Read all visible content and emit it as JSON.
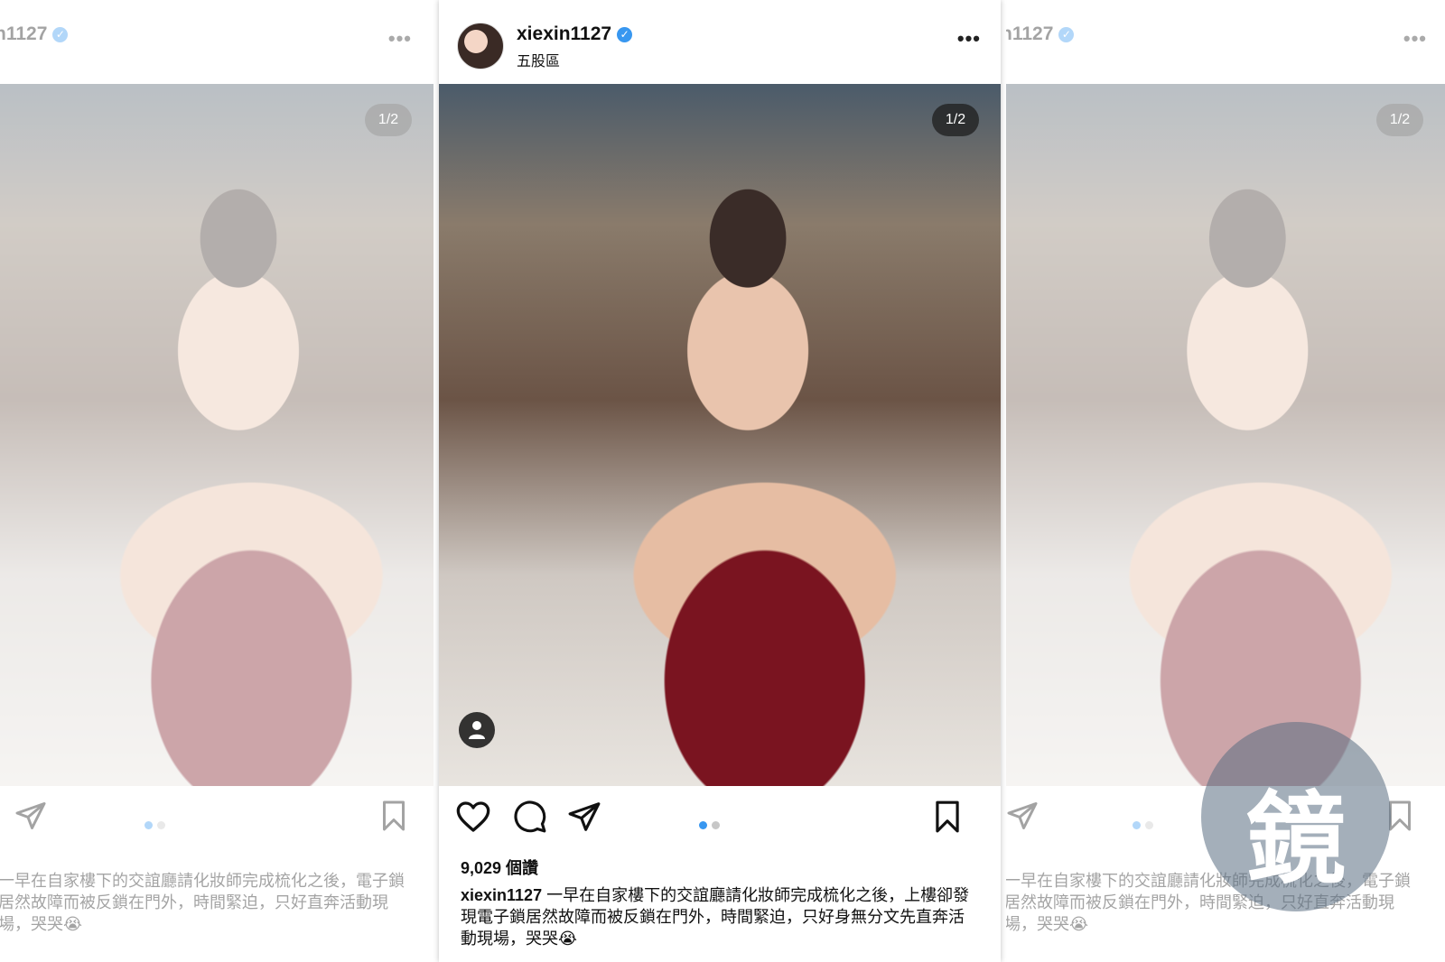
{
  "post": {
    "username": "xiexin1127",
    "location": "五股區",
    "more_label": "•••",
    "counter": "1/2",
    "likes": "9,029 個讚",
    "caption_user": "xiexin1127",
    "caption_text": "一早在自家樓下的交誼廳請化妝師完成梳化之後，上樓卻發現電子鎖居然故障而被反鎖在門外，時間緊迫，只好身無分文先直奔活動現場，哭哭😭",
    "side_caption": "一早在自家樓下的交誼廳請化妝師完成梳化之後，電子鎖居然故障而被反鎖在門外，時間緊迫，只好直奔活動現場，哭哭😭",
    "side_username": "n1127"
  },
  "carousel": {
    "total": 2,
    "current": 1
  },
  "watermark": {
    "text": "鏡"
  },
  "colors": {
    "accent": "#3897f0",
    "text": "#111111"
  }
}
